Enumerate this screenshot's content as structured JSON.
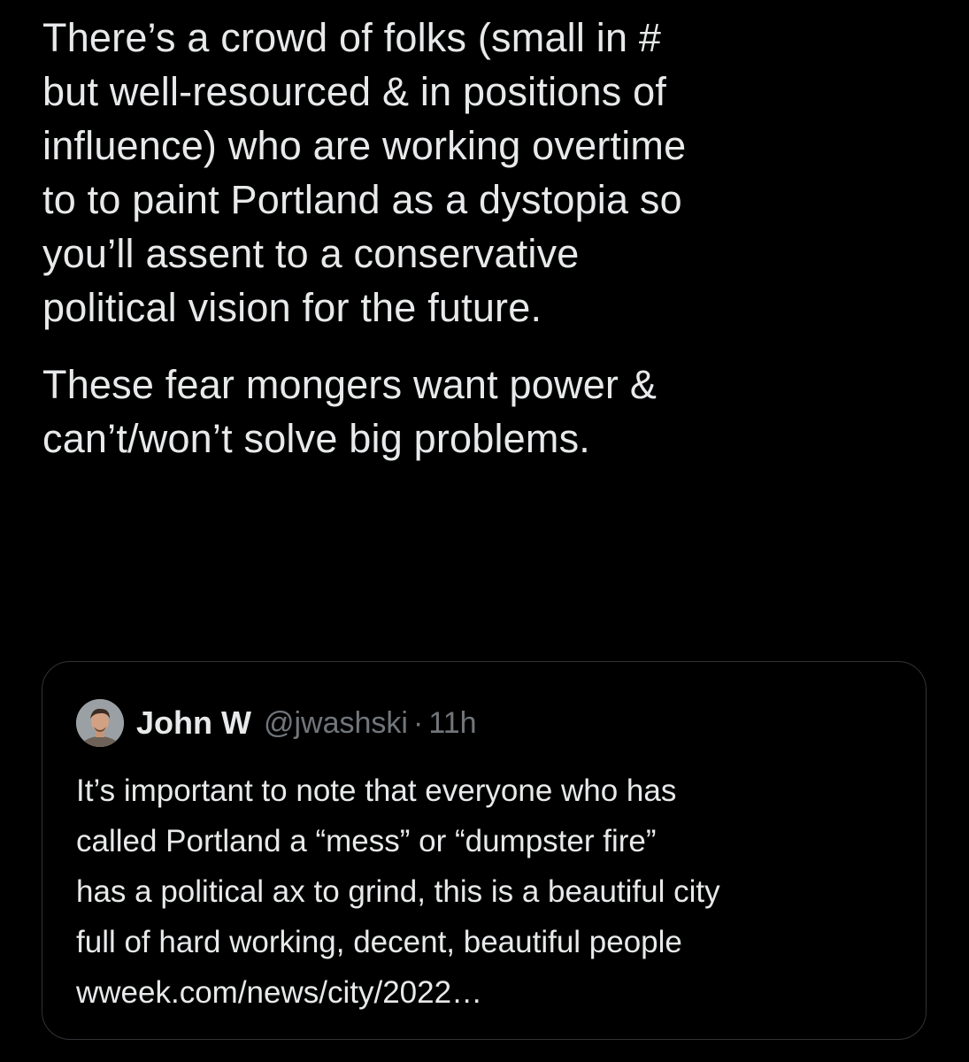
{
  "tweet": {
    "paragraph_1": "There’s a crowd of folks (small in #\nbut well-resourced & in positions of\ninfluence) who are working overtime\nto to paint Portland as a dystopia so\nyou’ll assent to a conservative\npolitical vision for the future.",
    "paragraph_2": "These fear mongers want power &\ncan’t/won’t solve big problems."
  },
  "quoted_tweet": {
    "author_name": "John W",
    "author_handle": "@jwashski",
    "separator": "·",
    "timestamp": "11h",
    "body": "It’s important to note that everyone who has\ncalled Portland a “mess” or “dumpster fire”\nhas a political ax to grind, this is a beautiful city\nfull of hard working, decent, beautiful people\nwweek.com/news/city/2022…"
  },
  "colors": {
    "background": "#000000",
    "primary_text": "#e7e9ea",
    "secondary_text": "#71767b",
    "card_border": "#2f3336"
  }
}
